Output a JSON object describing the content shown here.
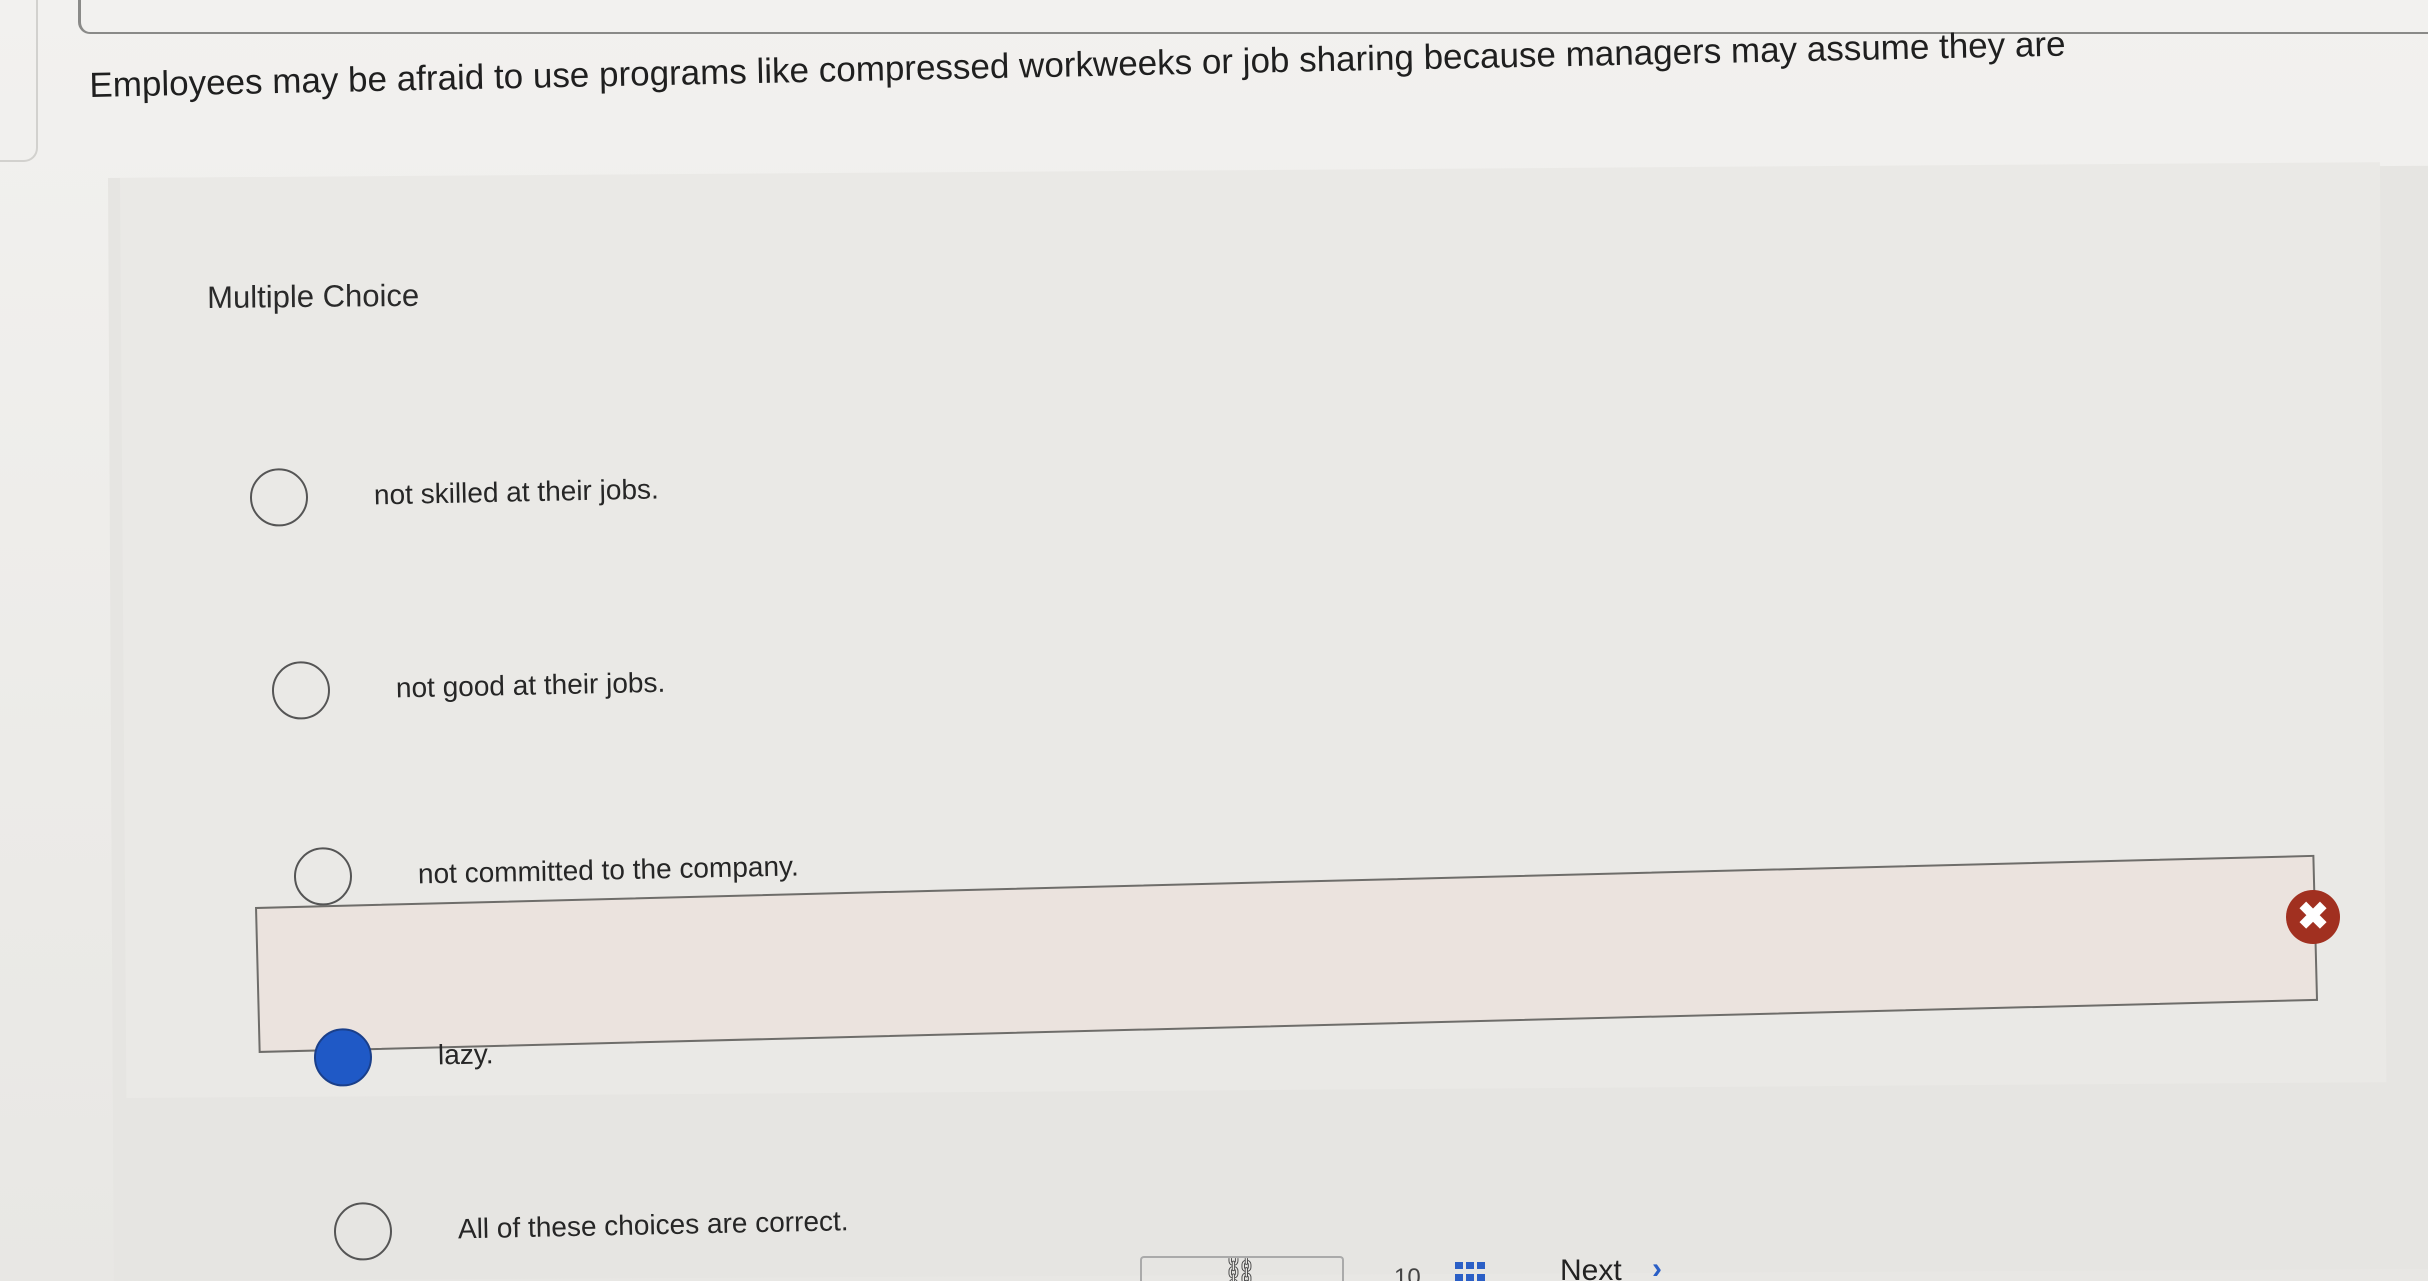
{
  "question": {
    "text": "Employees may be afraid to use programs like compressed workweeks or job sharing because managers may assume they are"
  },
  "quiz": {
    "type_label": "Multiple Choice",
    "options": [
      {
        "label": "not skilled at their jobs.",
        "selected": false
      },
      {
        "label": "not good at their jobs.",
        "selected": false
      },
      {
        "label": "not committed to the company.",
        "selected": false
      },
      {
        "label": "lazy.",
        "selected": true,
        "marked_incorrect": true
      },
      {
        "label": "All of these choices are correct.",
        "selected": false
      }
    ],
    "incorrect_glyph": "✖"
  },
  "footer": {
    "page_number": "10",
    "next_label": "Next",
    "next_glyph": "›",
    "link_glyph": "⛓"
  },
  "colors": {
    "selected_radio": "#1f59c6",
    "incorrect_badge": "#a13020",
    "accent": "#2b5fc6"
  }
}
